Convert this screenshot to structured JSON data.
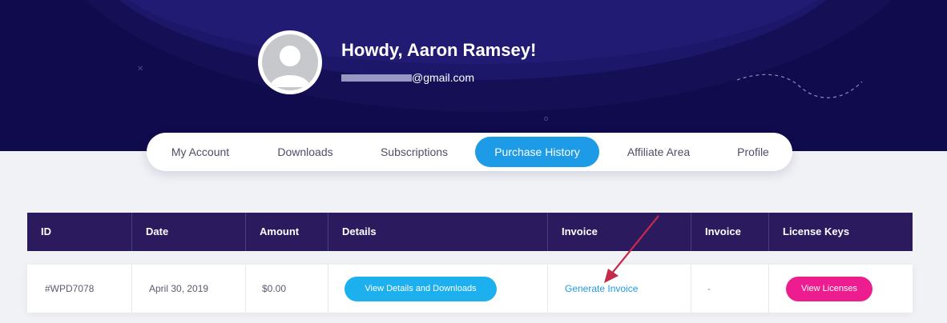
{
  "header": {
    "greeting": "Howdy, Aaron Ramsey!",
    "email_domain": "@gmail.com"
  },
  "nav": {
    "tabs": [
      {
        "label": "My Account",
        "active": false
      },
      {
        "label": "Downloads",
        "active": false
      },
      {
        "label": "Subscriptions",
        "active": false
      },
      {
        "label": "Purchase History",
        "active": true
      },
      {
        "label": "Affiliate Area",
        "active": false
      },
      {
        "label": "Profile",
        "active": false
      }
    ]
  },
  "table": {
    "headers": [
      "ID",
      "Date",
      "Amount",
      "Details",
      "Invoice",
      "Invoice",
      "License Keys"
    ],
    "rows": [
      {
        "id": "#WPD7078",
        "date": "April 30, 2019",
        "amount": "$0.00",
        "details_button": "View Details and Downloads",
        "invoice_link": "Generate Invoice",
        "invoice2": "-",
        "license_button": "View Licenses"
      }
    ]
  },
  "colors": {
    "hero_bg": "#0f0b4c",
    "table_header_bg": "#2b1a5e",
    "accent_blue": "#1d9be6",
    "accent_pink": "#ed1c8f",
    "arrow_red": "#c42a4a"
  },
  "icons": [
    "avatar-placeholder-icon",
    "annotation-arrow"
  ]
}
